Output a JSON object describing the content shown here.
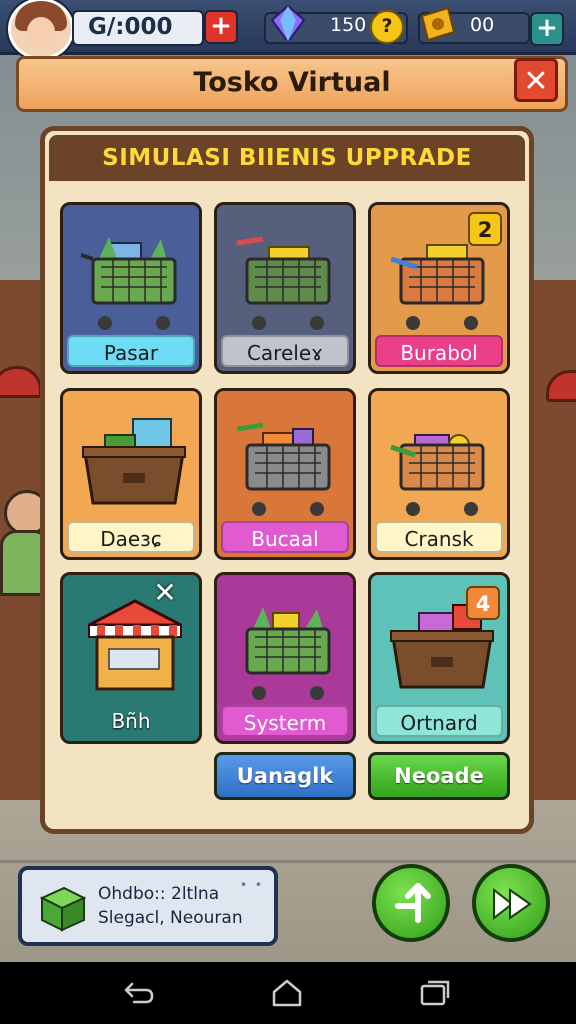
{
  "header": {
    "coins": "G/:000",
    "gems": "150",
    "help_symbol": "?",
    "tickets": "00",
    "plus_symbol": "+"
  },
  "title": {
    "text": "Tosko Virtual",
    "close_symbol": "✕"
  },
  "panel": {
    "heading": "SIMULASI BIIENIS UPPRADE",
    "cards": [
      {
        "label": "Pasar",
        "icon": "cart-icon",
        "badge": ""
      },
      {
        "label": "Careleɤ",
        "icon": "cart-icon",
        "badge": ""
      },
      {
        "label": "Burabol",
        "icon": "cart-icon",
        "badge": "2"
      },
      {
        "label": "Daeɜɕ",
        "icon": "crate-icon",
        "badge": ""
      },
      {
        "label": "Bucaal",
        "icon": "cart-icon",
        "badge": ""
      },
      {
        "label": "Cransk",
        "icon": "cart-icon",
        "badge": ""
      },
      {
        "label": "Bñh",
        "icon": "market-stall-icon",
        "badge": "✕"
      },
      {
        "label": "Systerm",
        "icon": "cart-icon",
        "badge": ""
      },
      {
        "label": "Ortnard",
        "icon": "crate-icon",
        "badge": "4"
      }
    ],
    "buttons": {
      "left": "Uanaglk",
      "right": "Neoade"
    }
  },
  "info": {
    "line1": "Ohdbo:: 2ltlna",
    "line2": "Slegacl, Neouran",
    "dots": "• •"
  },
  "colors": {
    "accent_orange": "#eea35c",
    "panel_bg": "#f4e3c3",
    "heading_yellow": "#ffd83a",
    "button_blue": "#3f7fd6",
    "button_green": "#46b52a",
    "close_red": "#e14a2e"
  }
}
